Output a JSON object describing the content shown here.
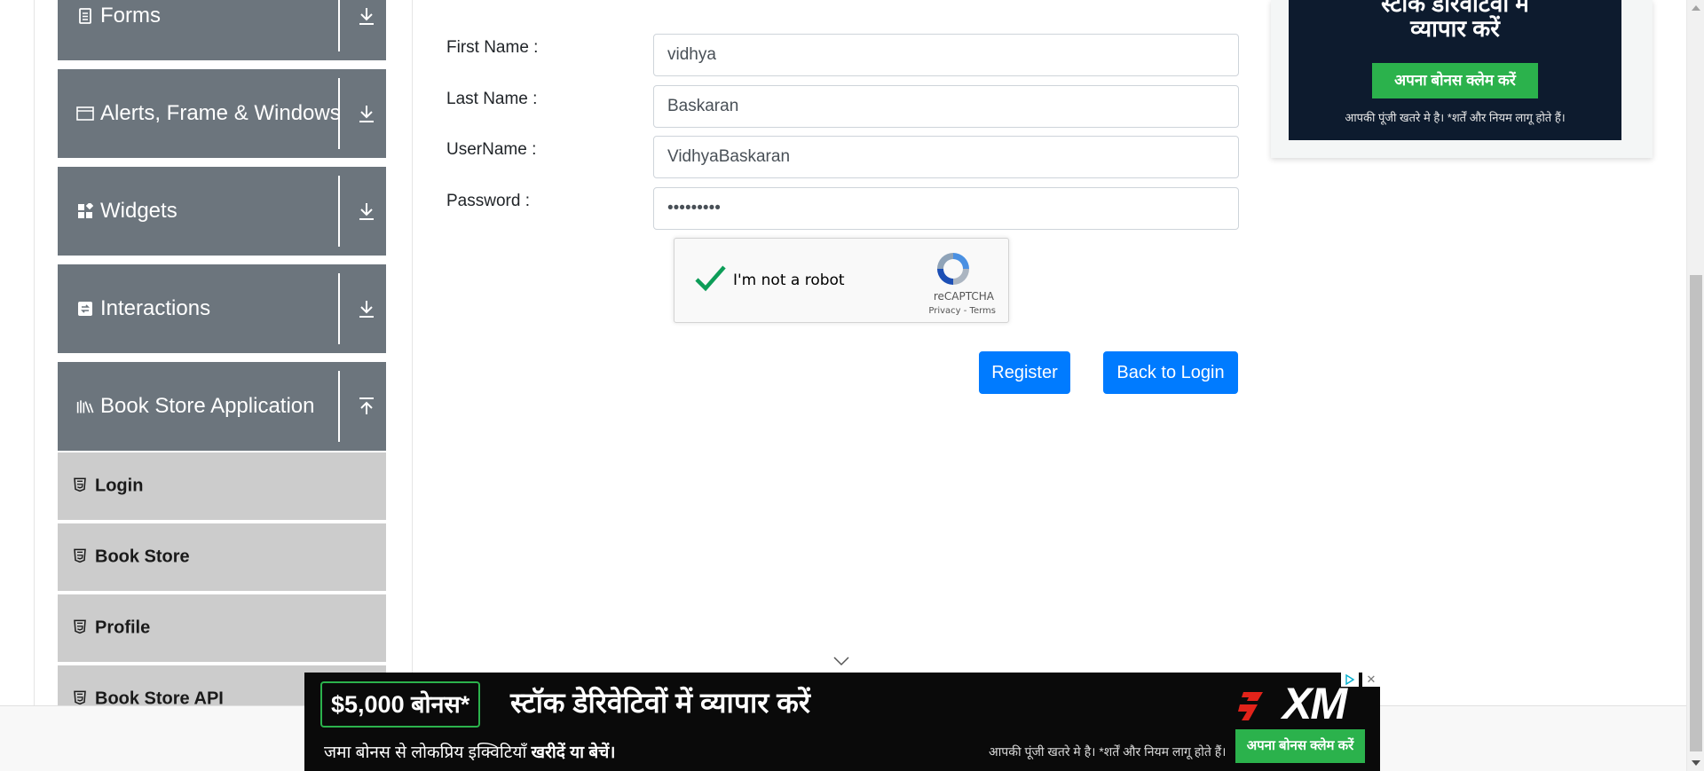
{
  "sidebar": {
    "groups": [
      {
        "label": "Forms",
        "icon": "document-icon",
        "toggle": "expand-down-icon"
      },
      {
        "label": "Alerts, Frame & Windows",
        "icon": "window-icon",
        "toggle": "expand-down-icon"
      },
      {
        "label": "Widgets",
        "icon": "widgets-icon",
        "toggle": "expand-down-icon"
      },
      {
        "label": "Interactions",
        "icon": "interactions-icon",
        "toggle": "expand-down-icon"
      },
      {
        "label": "Book Store Application",
        "icon": "books-icon",
        "toggle": "collapse-up-icon"
      }
    ],
    "items": [
      {
        "label": "Login",
        "icon": "html5-icon"
      },
      {
        "label": "Book Store",
        "icon": "html5-icon"
      },
      {
        "label": "Profile",
        "icon": "html5-icon"
      },
      {
        "label": "Book Store API",
        "icon": "html5-icon"
      }
    ]
  },
  "form": {
    "fields": [
      {
        "label": "First Name :",
        "value": "vidhya",
        "type": "text"
      },
      {
        "label": "Last Name :",
        "value": "Baskaran",
        "type": "text"
      },
      {
        "label": "UserName :",
        "value": "VidhyaBaskaran",
        "type": "text"
      },
      {
        "label": "Password :",
        "value": "vidhya@12",
        "type": "password"
      }
    ],
    "captcha": {
      "label": "I'm not a robot",
      "brand": "reCAPTCHA",
      "links": "Privacy - Terms",
      "checked": true
    },
    "buttons": {
      "register": "Register",
      "back_to_login": "Back to Login"
    }
  },
  "side_ad": {
    "headline_line1": "स्टॉक डेरिवेटिवों में",
    "headline_line2": "व्यापार करें",
    "cta": "अपना बोनस क्लेम करें",
    "note": "आपकी पूंजी खतरे मे है। *शर्तें और नियम लागू होते हैं।"
  },
  "bottom_ad": {
    "bonus": "$5,000 बोनस*",
    "headline": "स्टॉक डेरिवेटिवों में व्यापार करें",
    "sub_prefix": "जमा बोनस से लोकप्रिय इक्विटियाँ ",
    "sub_bold": "खरीदें या बेचें।",
    "risk": "आपकी पूंजी खतरे मे है। *शर्तें और नियम लागू होते हैं।",
    "cta": "अपना बोनस क्लेम करें",
    "brand": "XM",
    "close": "✕"
  },
  "colors": {
    "sidebar_group": "#6c757d",
    "sidebar_item": "#cccccc",
    "primary": "#007bff",
    "ad_green": "#2bb24c"
  }
}
